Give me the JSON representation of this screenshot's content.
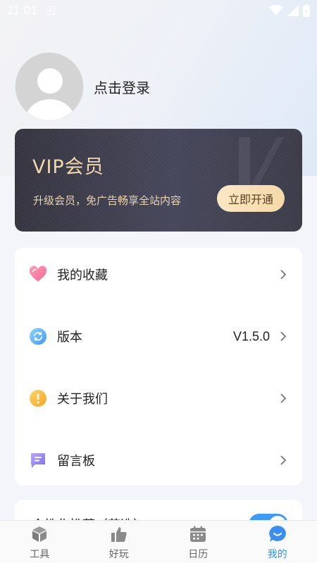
{
  "status_bar": {
    "time": "11:01",
    "notification_icon": "A"
  },
  "profile": {
    "login_text": "点击登录"
  },
  "vip": {
    "title": "VIP会员",
    "subtitle": "升级会员，免广告畅享全站内容",
    "button_label": "立即开通",
    "colors": {
      "gold": "#f1d9ad",
      "card": "#3b3b48"
    }
  },
  "menu": {
    "items": [
      {
        "label": "我的收藏",
        "icon": "heart-icon",
        "value": ""
      },
      {
        "label": "版本",
        "icon": "refresh-icon",
        "value": "V1.5.0"
      },
      {
        "label": "关于我们",
        "icon": "exclamation-icon",
        "value": ""
      },
      {
        "label": "留言板",
        "icon": "message-icon",
        "value": ""
      }
    ]
  },
  "switch_row": {
    "label": "个性化推荐（节选）",
    "enabled": true
  },
  "tabs": [
    {
      "label": "工具",
      "icon": "cube-icon",
      "active": false
    },
    {
      "label": "好玩",
      "icon": "thumbs-up-icon",
      "active": false
    },
    {
      "label": "日历",
      "icon": "calendar-icon",
      "active": false
    },
    {
      "label": "我的",
      "icon": "chat-bubble-icon",
      "active": true
    }
  ],
  "accent_color": "#3b8ff0"
}
